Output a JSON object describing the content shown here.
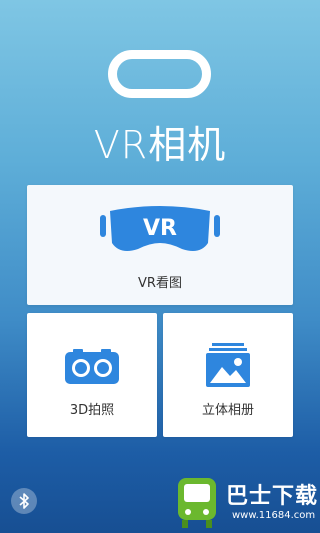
{
  "app": {
    "title": "VR相机"
  },
  "menu": {
    "vr_view": {
      "icon_text": "VR",
      "label": "VR看图"
    },
    "photo_3d": {
      "label": "3D拍照"
    },
    "stereo_album": {
      "label": "立体相册"
    }
  },
  "icons": {
    "logo": "vr-headset-ring-icon",
    "vr_view": "vr-headset-icon",
    "photo_3d": "stereo-camera-icon",
    "stereo_album": "photo-album-icon",
    "bluetooth": "bluetooth-icon"
  },
  "watermark": {
    "text": "巴士下载",
    "url": "www.11684.com"
  },
  "colors": {
    "accent": "#2e86de",
    "card": "#ffffff",
    "text": "#333333"
  }
}
